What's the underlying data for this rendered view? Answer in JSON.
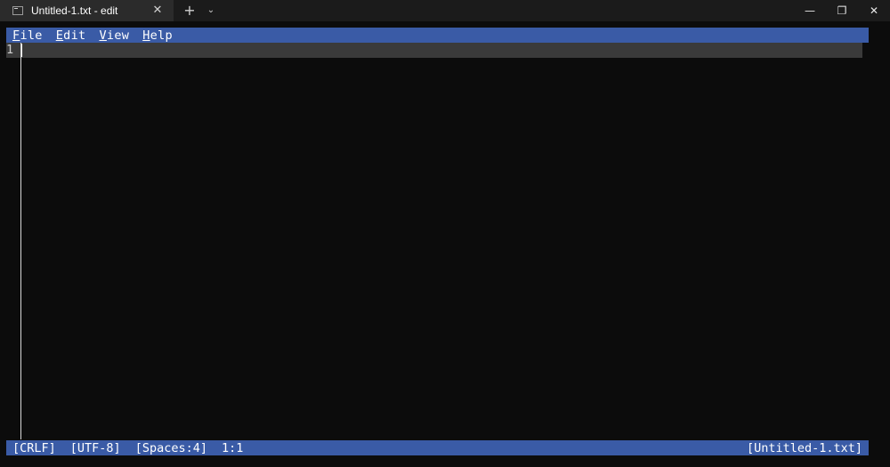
{
  "window": {
    "tab_title": "Untitled-1.txt - edit",
    "tab_icon": "terminal-icon",
    "tab_close_glyph": "✕",
    "new_tab_glyph": "+",
    "dropdown_glyph": "⌄",
    "minimize_glyph": "—",
    "maximize_glyph": "❐",
    "close_glyph": "✕"
  },
  "menu": {
    "items": [
      {
        "first": "F",
        "rest": "ile"
      },
      {
        "first": "E",
        "rest": "dit"
      },
      {
        "first": "V",
        "rest": "iew"
      },
      {
        "first": "H",
        "rest": "elp"
      }
    ]
  },
  "editor": {
    "line_number": "1"
  },
  "status": {
    "line_ending": "[CRLF]",
    "encoding": "[UTF-8]",
    "indentation": "[Spaces:4]",
    "position": "1:1",
    "filename": "[Untitled-1.txt]"
  },
  "colors": {
    "background": "#0c0c0c",
    "bar_blue": "#3a5ba6",
    "current_line": "#3a3a3a"
  }
}
